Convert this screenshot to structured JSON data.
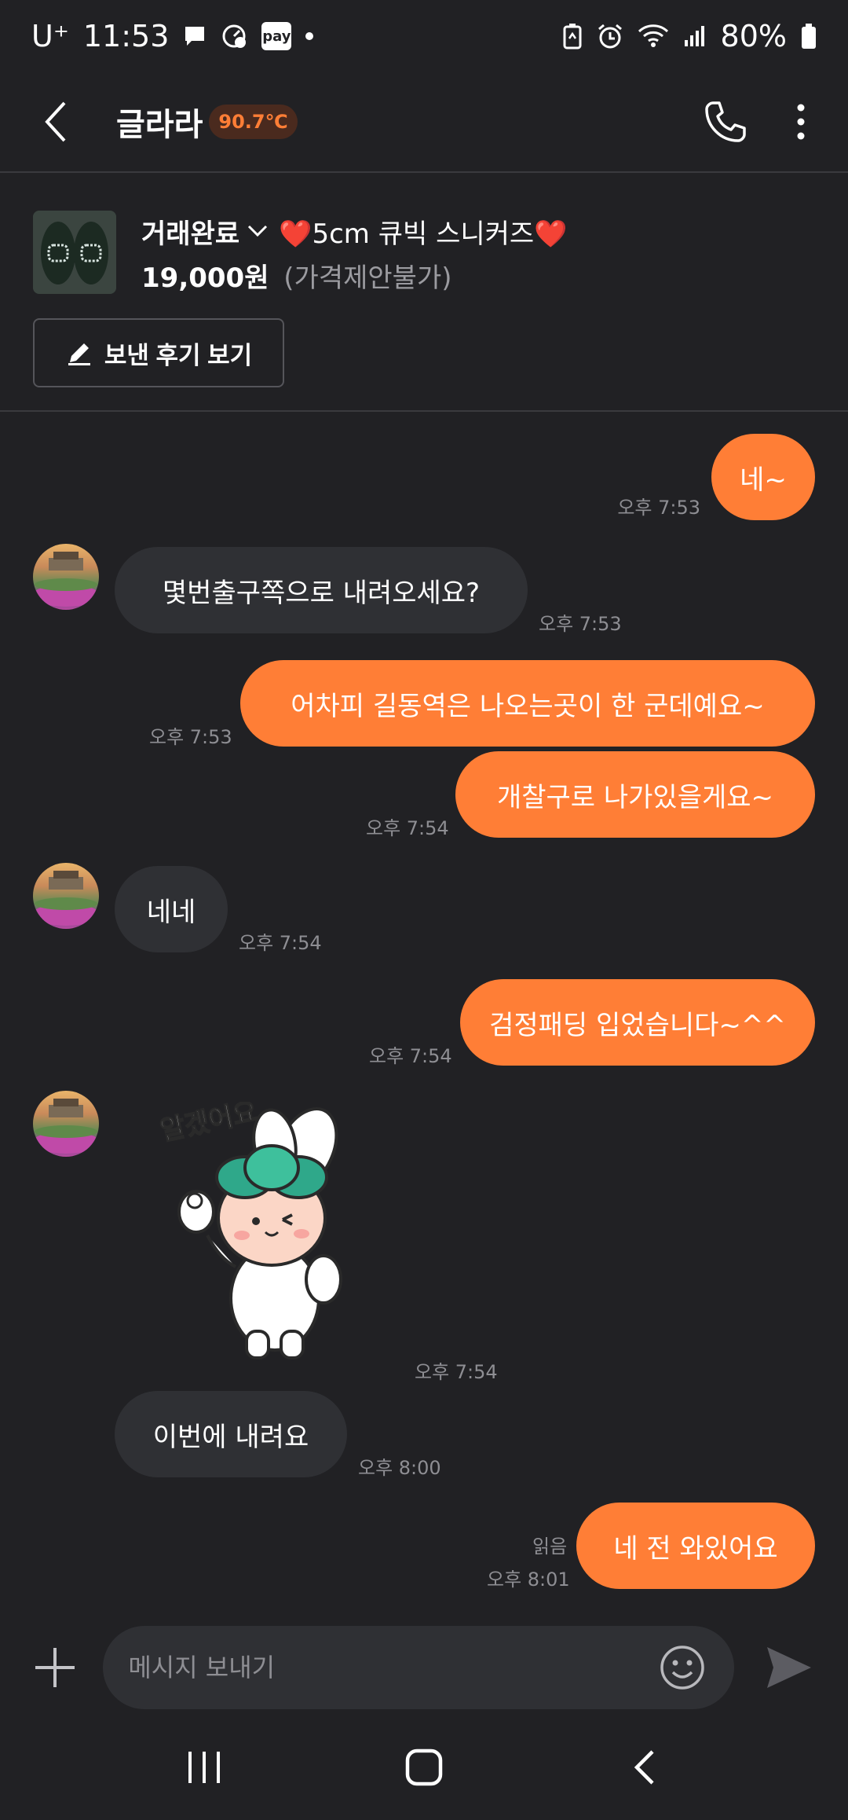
{
  "status_bar": {
    "carrier": "U⁺",
    "time": "11:53",
    "pay_label": "pay",
    "battery": "80%"
  },
  "header": {
    "nickname": "글라라",
    "temperature": "90.7℃"
  },
  "product": {
    "status": "거래완료",
    "title": "❤️5cm 큐빅 스니커즈❤️",
    "price": "19,000원",
    "price_note": "(가격제안불가)",
    "review_button": "보낸 후기 보기"
  },
  "messages": [
    {
      "sender": "me",
      "text": "네~",
      "time": "오후 7:53"
    },
    {
      "sender": "them",
      "text": "몇번출구쪽으로 내려오세요?",
      "time": "오후 7:53"
    },
    {
      "sender": "me",
      "text": "어차피 길동역은 나오는곳이 한 군데예요~",
      "time": "오후 7:53"
    },
    {
      "sender": "me",
      "text": "개찰구로 나가있을게요~",
      "time": "오후 7:54"
    },
    {
      "sender": "them",
      "text": "네네",
      "time": "오후 7:54"
    },
    {
      "sender": "me",
      "text": "검정패딩 입었습니다~^^",
      "time": "오후 7:54"
    },
    {
      "sender": "them",
      "type": "sticker",
      "sticker_text": "알겠어요",
      "time": "오후 7:54"
    },
    {
      "sender": "them",
      "text": "이번에 내려요",
      "time": "오후 8:00"
    },
    {
      "sender": "me",
      "text": "네 전 와있어요",
      "time": "오후 8:01",
      "read": "읽음"
    }
  ],
  "input": {
    "placeholder": "메시지 보내기",
    "value": ""
  },
  "colors": {
    "background": "#212124",
    "accent": "#ff7e36",
    "bubble_them": "#2f3034",
    "muted_text": "#8e8e93"
  }
}
